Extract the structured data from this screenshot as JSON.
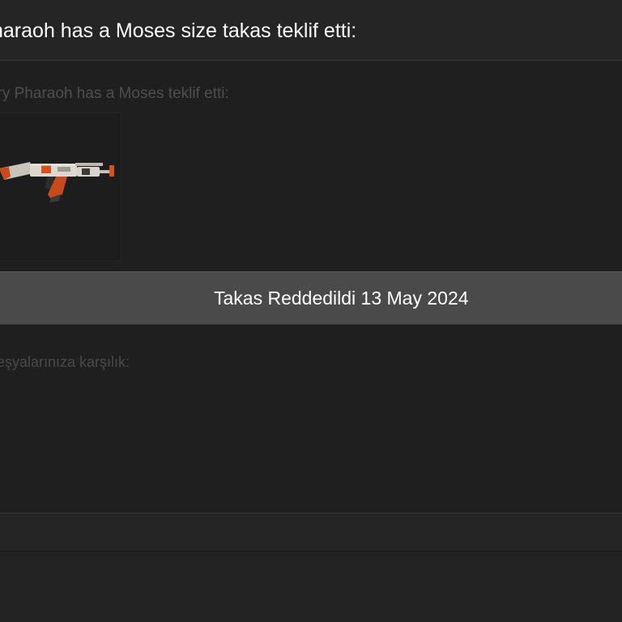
{
  "header": {
    "title": "haraoh has a Moses size takas teklif etti:"
  },
  "offer": {
    "label": "ery Pharaoh has a Moses teklif etti:",
    "item": {
      "icon": "ak47-rifle-icon",
      "colors": {
        "body": "#d9d4cc",
        "accent": "#d4521e",
        "dark": "#3a3a3a"
      }
    }
  },
  "status": {
    "text": "Takas Reddedildi 13 May 2024"
  },
  "return": {
    "label": "eşyalarınıza karşılık:"
  }
}
